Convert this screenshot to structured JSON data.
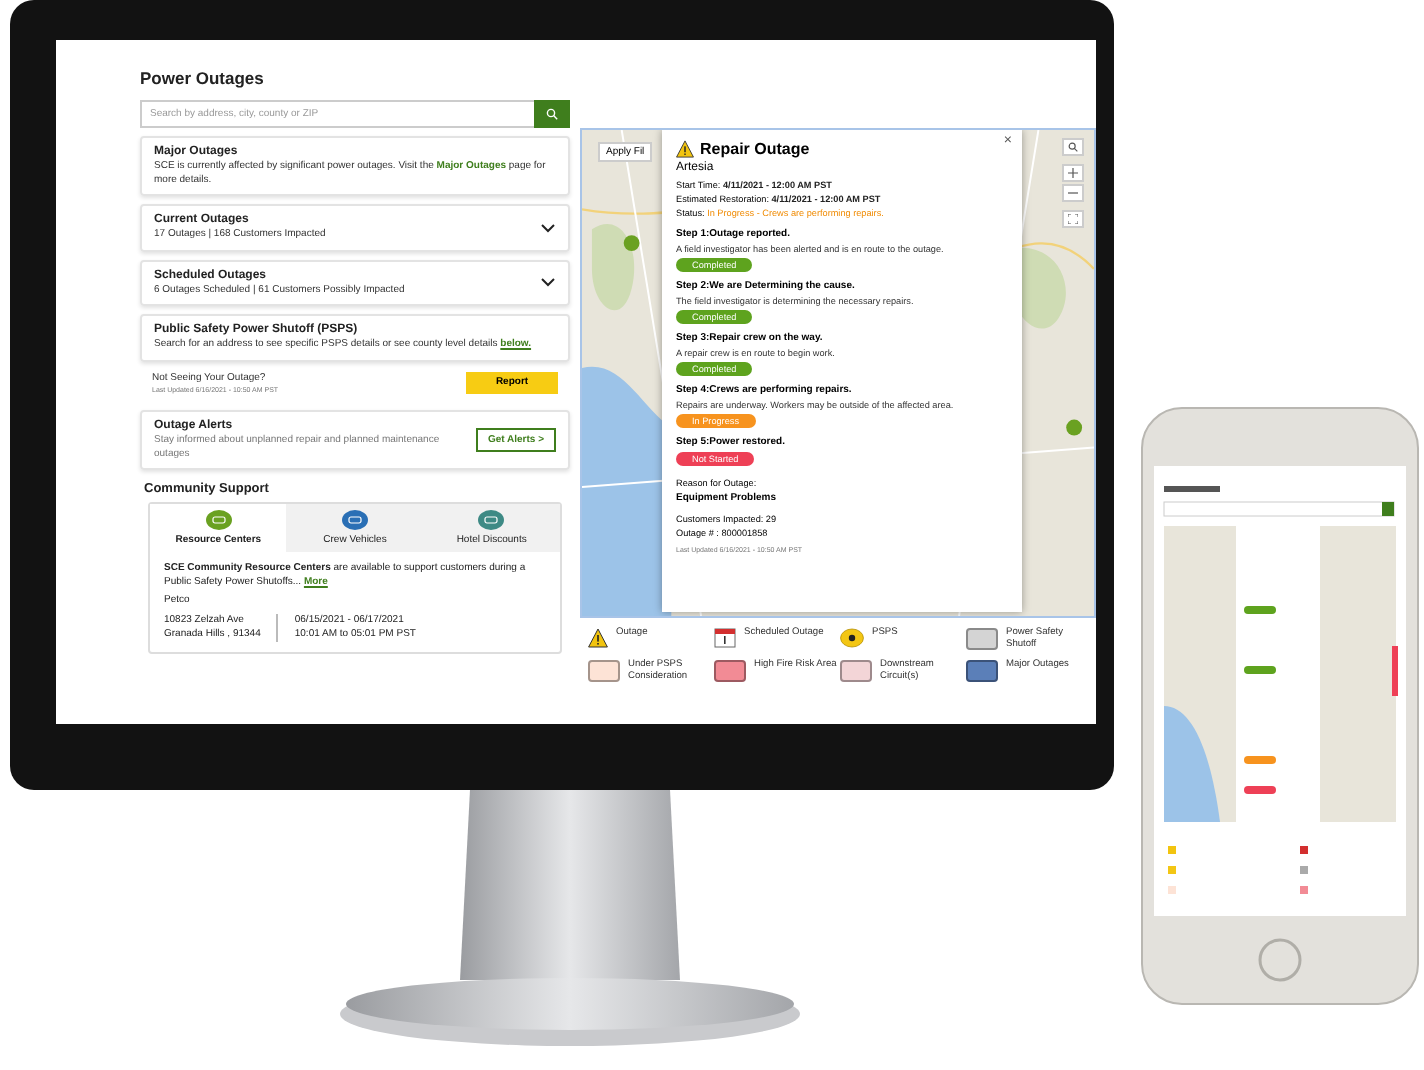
{
  "left_panel": {
    "title": "Power Outages",
    "search": {
      "placeholder": "Search by address, city, county or ZIP"
    },
    "major": {
      "title": "Major Outages",
      "text_before": "SCE is currently affected by significant power outages. Visit the ",
      "link": "Major Outages",
      "text_after": " page for more details."
    },
    "outage_cards": [
      {
        "title": "Current Outages",
        "summary": "17 Outages | 168 Customers Impacted",
        "expanded": false
      },
      {
        "title": "Scheduled Outages",
        "summary": "6 Outages Scheduled | 61 Customers Possibly Impacted",
        "expanded": false
      }
    ],
    "psps": {
      "title": "Public Safety Power Shutoff (PSPS)",
      "text": "Search for an address to see specific PSPS details or see county level details",
      "link": "below."
    },
    "report": {
      "title": "Not Seeing Your Outage?",
      "updated": "Last Updated 6/16/2021 - 10:50 AM PST",
      "button": "Report"
    },
    "alerts": {
      "title": "Outage Alerts",
      "text": "Stay informed about unplanned repair and planned maintenance outages",
      "button": "Get Alerts >"
    },
    "community": {
      "title": "Community Support",
      "tabs": [
        {
          "label": "Resource Centers",
          "selected": true,
          "color": "#6aa121"
        },
        {
          "label": "Crew Vehicles",
          "selected": false,
          "color": "#2a6fb5"
        },
        {
          "label": "Hotel Discounts",
          "selected": false,
          "color": "#3e8a85"
        }
      ],
      "intro": "**SCE Community Resource Centers** are available to support customers during a Public Safety Power Shutoffs...",
      "more": "More",
      "center": {
        "name": "Petco",
        "address": "10823 Zelzah Ave",
        "city": "Granada Hills , 91344",
        "dates": "06/15/2021 - 06/17/2021",
        "hours": "10:01 AM to 05:01 PM PST"
      }
    }
  },
  "map": {
    "filter_button": "Apply Fil",
    "popup": {
      "title": "Repair Outage",
      "location": "Artesia",
      "close": "×",
      "facts": [
        {
          "label": "Start Time: ",
          "value": "4/11/2021 - 12:00 AM PST",
          "kind": "bold"
        },
        {
          "label": "Estimated Restoration: ",
          "value": "4/11/2021 - 12:00 AM PST",
          "kind": "bold"
        },
        {
          "label": "Status: ",
          "value": "In Progress - Crews are performing repairs.",
          "kind": "status"
        }
      ],
      "steps": [
        {
          "title": "Step 1:Outage reported.",
          "text": "A field investigator has been alerted and is en route to the outage.",
          "status": "Completed",
          "kind": "completed"
        },
        {
          "title": "Step 2:We are Determining the cause.",
          "text": "The field investigator is determining the necessary repairs.",
          "status": "Completed",
          "kind": "completed"
        },
        {
          "title": "Step 3:Repair crew on the way.",
          "text": "A repair crew is en route to begin work.",
          "status": "Completed",
          "kind": "completed"
        },
        {
          "title": "Step 4:Crews are performing repairs.",
          "text": "Repairs are underway. Workers may be outside of the affected area.",
          "status": "In Progress",
          "kind": "progress"
        },
        {
          "title": "Step 5:Power restored.",
          "status": "Not Started",
          "kind": "not_started"
        }
      ],
      "reason_label": "Reason for Outage:",
      "reason": "Equipment Problems",
      "customers": "Customers Impacted: 29",
      "outage_number": "Outage # : 800001858",
      "updated": "Last Updated 6/16/2021 - 10:50 AM PST"
    }
  },
  "legend": [
    {
      "label": "Outage",
      "kind": "warning"
    },
    {
      "label": "Scheduled Outage",
      "kind": "calendar"
    },
    {
      "label": "PSPS",
      "kind": "psps"
    },
    {
      "label": "Power Safety Shutoff",
      "kind": "swatch",
      "color": "#d4d4d4"
    },
    {
      "label": "Under PSPS Consideration",
      "kind": "swatch",
      "color": "#fde3d6"
    },
    {
      "label": "High Fire Risk Area",
      "kind": "swatch",
      "color": "#f28b95"
    },
    {
      "label": "Downstream Circuit(s)",
      "kind": "swatch",
      "color": "#f3d5d7"
    },
    {
      "label": "Major Outages",
      "kind": "swatch",
      "color": "#5b7fb8"
    }
  ]
}
